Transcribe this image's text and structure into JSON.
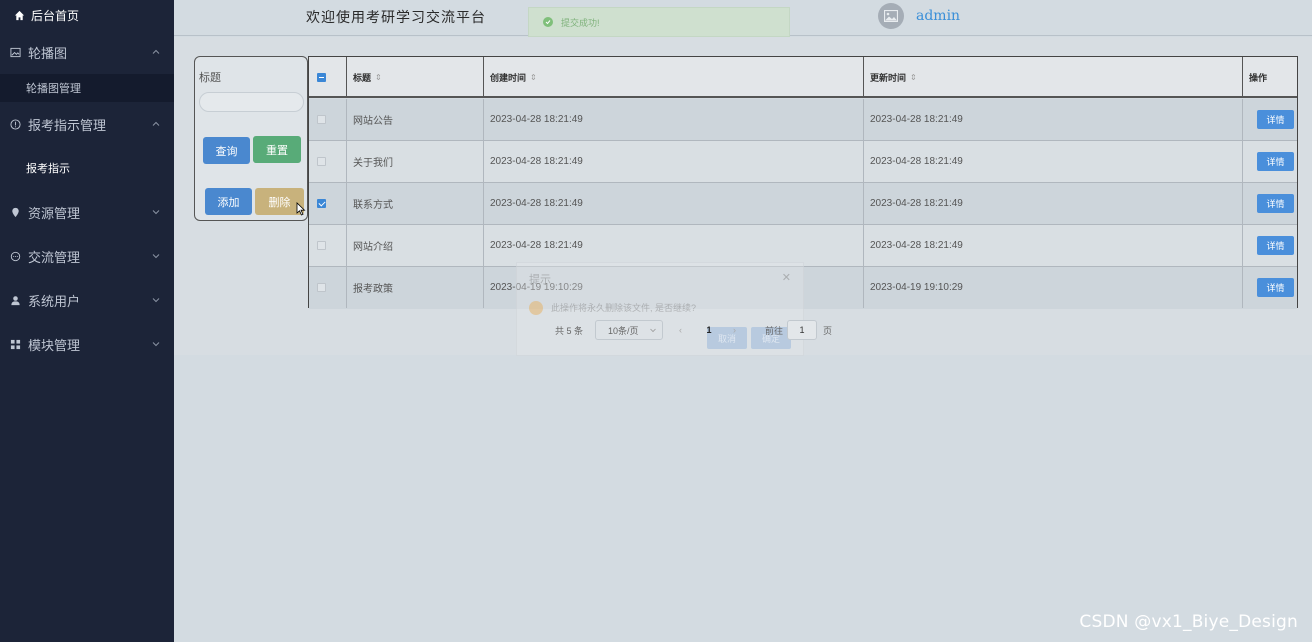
{
  "sidebar": {
    "home": "后台首页",
    "groups": [
      {
        "label": "轮播图",
        "icon": "image-icon",
        "children": [
          "轮播图管理"
        ]
      },
      {
        "label": "报考指示管理",
        "icon": "info-icon",
        "children": [
          "报考指示"
        ]
      },
      {
        "label": "资源管理",
        "icon": "pin-icon"
      },
      {
        "label": "交流管理",
        "icon": "chat-icon"
      },
      {
        "label": "系统用户",
        "icon": "user-icon"
      },
      {
        "label": "模块管理",
        "icon": "grid-icon"
      }
    ]
  },
  "header": {
    "title": "欢迎使用考研学习交流平台",
    "username": "admin"
  },
  "toast": {
    "message": "提交成功!"
  },
  "search": {
    "label": "标题",
    "value": "",
    "query_btn": "查询",
    "reset_btn": "重置",
    "add_btn": "添加",
    "delete_btn": "删除"
  },
  "table": {
    "columns": [
      "标题",
      "创建时间",
      "更新时间",
      "操作"
    ],
    "rows": [
      {
        "title": "网站公告",
        "created": "2023-04-28 18:21:49",
        "updated": "2023-04-28 18:21:49",
        "action": "详情",
        "checked": false
      },
      {
        "title": "关于我们",
        "created": "2023-04-28 18:21:49",
        "updated": "2023-04-28 18:21:49",
        "action": "详情",
        "checked": false
      },
      {
        "title": "联系方式",
        "created": "2023-04-28 18:21:49",
        "updated": "2023-04-28 18:21:49",
        "action": "详情",
        "checked": true
      },
      {
        "title": "网站介绍",
        "created": "2023-04-28 18:21:49",
        "updated": "2023-04-28 18:21:49",
        "action": "详情",
        "checked": false
      },
      {
        "title": "报考政策",
        "created": "2023-04-19 19:10:29",
        "updated": "2023-04-19 19:10:29",
        "action": "详情",
        "checked": false
      }
    ]
  },
  "pagination": {
    "total": "共 5 条",
    "page_size": "10条/页",
    "current_page": "1",
    "goto_label": "前往",
    "goto_value": "1",
    "page_unit": "页"
  },
  "dialog": {
    "title": "提示",
    "message": "此操作将永久删除该文件, 是否继续?",
    "cancel": "取消",
    "confirm": "确定"
  },
  "watermark": "CSDN @vx1_Biye_Design",
  "colors": {
    "sidebar_bg": "#1c2438",
    "primary": "#4a88cf",
    "success": "#58ab78",
    "warning": "#c8b27c",
    "link": "#3a8fd8"
  }
}
